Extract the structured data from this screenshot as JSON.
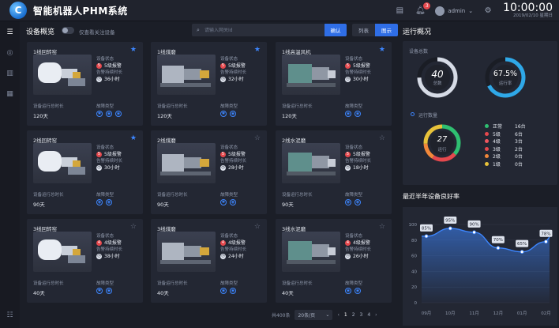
{
  "header": {
    "app_title": "智能机器人PHM系统",
    "notification_count": "3",
    "user_name": "admin",
    "time": "10:00:00",
    "date": "2019/02/10 星期日"
  },
  "overview": {
    "title": "设备概览",
    "toggle_label": "仅查看关注设备",
    "search_placeholder": "请输入网关Id",
    "confirm_label": "确认",
    "view_list_label": "列表",
    "view_grid_label": "图示"
  },
  "labels": {
    "status": "设备状态",
    "alarm_duration": "告警持续时长",
    "run_total": "设备运行总时长",
    "fault_type": "故障类型"
  },
  "cards": [
    {
      "name": "1线回转窑",
      "starred": true,
      "alarm": "5级报警",
      "level": "5",
      "duration": "36小时",
      "run": "120天",
      "faults": [
        "✱",
        "◉",
        "◉"
      ]
    },
    {
      "name": "1线煤磨",
      "starred": true,
      "alarm": "5级报警",
      "level": "5",
      "duration": "32小时",
      "run": "120天",
      "faults": [
        "✱",
        "◉"
      ]
    },
    {
      "name": "1线高温风机",
      "starred": true,
      "alarm": "5级报警",
      "level": "5",
      "duration": "30小时",
      "run": "120天",
      "faults": [
        "◉",
        "◉"
      ]
    },
    {
      "name": "2线回转窑",
      "starred": true,
      "alarm": "5级报警",
      "level": "5",
      "duration": "30小时",
      "run": "90天",
      "faults": [
        "◉",
        "◉"
      ]
    },
    {
      "name": "2线煤磨",
      "starred": false,
      "alarm": "5级报警",
      "level": "5",
      "duration": "28小时",
      "run": "90天",
      "faults": [
        "✱",
        "◉"
      ]
    },
    {
      "name": "2线水泥磨",
      "starred": false,
      "alarm": "5级报警",
      "level": "5",
      "duration": "18小时",
      "run": "90天",
      "faults": [
        "◉",
        "◉"
      ]
    },
    {
      "name": "3线回转窑",
      "starred": false,
      "alarm": "4级报警",
      "level": "4",
      "duration": "38小时",
      "run": "40天",
      "faults": [
        "✱",
        "◉"
      ]
    },
    {
      "name": "3线煤磨",
      "starred": false,
      "alarm": "4级报警",
      "level": "4",
      "duration": "24小时",
      "run": "40天",
      "faults": [
        "◉",
        "◉"
      ]
    },
    {
      "name": "3线水泥磨",
      "starred": false,
      "alarm": "4级报警",
      "level": "4",
      "duration": "26小时",
      "run": "40天",
      "faults": [
        "◉",
        "◉"
      ]
    }
  ],
  "pagination": {
    "total": "共400条",
    "page_size": "20条/页",
    "pages": [
      "1",
      "2",
      "3",
      "4"
    ],
    "current": "1"
  },
  "right": {
    "title": "运行概况",
    "device_total_label": "设备总数",
    "total_value": "40",
    "total_caption": "总数",
    "running_percent": "67.5%",
    "running_percent_value": 67.5,
    "running_caption": "运行率",
    "running_count_label": "运行数量",
    "running_value": "27",
    "running_value_caption": "运行",
    "legend": [
      {
        "label": "正常",
        "value": "16台",
        "color": "#2fbf71"
      },
      {
        "label": "5级",
        "value": "6台",
        "color": "#e5484d"
      },
      {
        "label": "4级",
        "value": "3台",
        "color": "#f0565f"
      },
      {
        "label": "3级",
        "value": "2台",
        "color": "#e5484d"
      },
      {
        "label": "2级",
        "value": "0台",
        "color": "#f2883a"
      },
      {
        "label": "1级",
        "value": "0台",
        "color": "#e8c23a"
      }
    ]
  },
  "chart_data": {
    "type": "area",
    "title": "最近半年设备良好率",
    "categories": [
      "09月",
      "10月",
      "11月",
      "12月",
      "01月",
      "02月"
    ],
    "values": [
      85,
      95,
      90,
      70,
      65,
      78
    ],
    "labels": [
      "85%",
      "95%",
      "90%",
      "70%",
      "65%",
      "78%"
    ],
    "yticks": [
      "0",
      "20",
      "40",
      "60",
      "80",
      "100"
    ],
    "ylim": [
      0,
      100
    ],
    "color": "#3d86ff"
  }
}
